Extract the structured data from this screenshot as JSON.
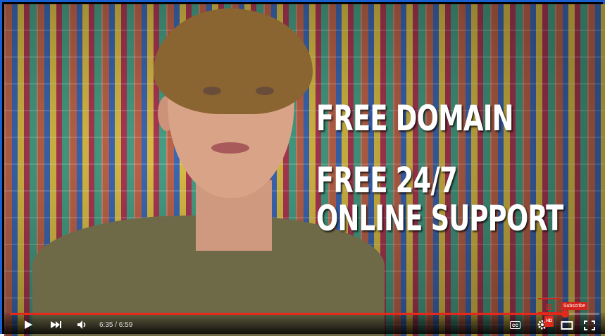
{
  "overlay": {
    "line1": "FREE DOMAIN",
    "line2": "FREE 24/7",
    "line3": "ONLINE SUPPORT"
  },
  "watermark": {
    "subscribe_label": "Subscribe"
  },
  "player": {
    "current_time": "6:35",
    "duration": "6:59",
    "time_display": "6:35 / 6:59",
    "progress_fraction": 0.942,
    "quality_badge": "HD",
    "cc_label": "cc",
    "accent_color": "#e12a1c",
    "frame_color": "#1a5fd0"
  }
}
